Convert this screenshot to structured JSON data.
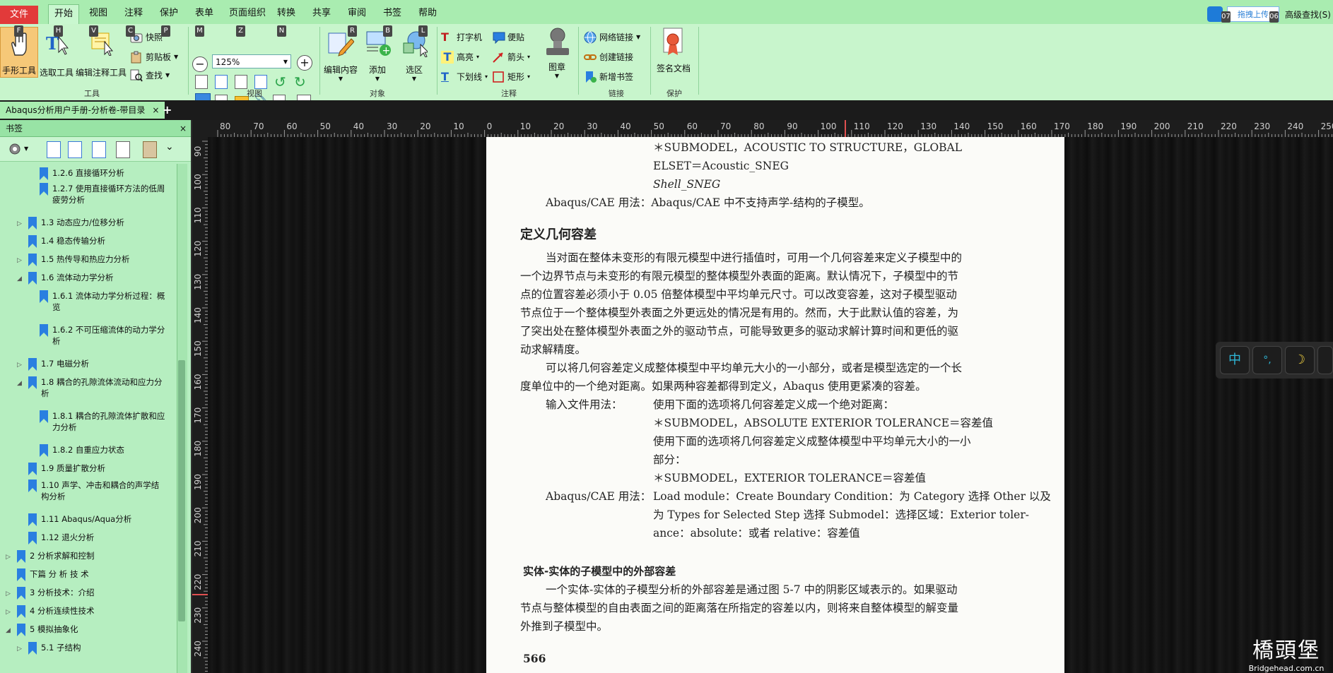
{
  "menubar": {
    "items": [
      "文件",
      "开始",
      "视图",
      "注释",
      "保护",
      "表单",
      "页面组织",
      "转换",
      "共享",
      "审阅",
      "书签",
      "帮助"
    ],
    "upload_label": "拖拽上传",
    "advanced_search": "高级查找(S)",
    "keytips_top": [
      "07",
      "06"
    ]
  },
  "ribbon": {
    "tools": {
      "hand": "手形工具",
      "select": "选取工具",
      "edit_annot": "编辑注释工具",
      "snapshot": "快照",
      "clipboard": "剪贴板",
      "find": "查找",
      "label": "工具"
    },
    "view": {
      "zoom": "125%",
      "label": "视图"
    },
    "objects": {
      "edit_content": "编辑内容",
      "add": "添加",
      "select_area": "选区",
      "label": "对象"
    },
    "annotations": {
      "typewriter": "打字机",
      "highlight": "高亮",
      "underline": "下划线",
      "note": "便贴",
      "arrow": "箭头",
      "rect": "矩形",
      "stamp": "图章",
      "label": "注释"
    },
    "links": {
      "web": "网络链接",
      "create": "创建链接",
      "bookmark": "新增书签",
      "label": "链接"
    },
    "protect": {
      "sign": "签名文档",
      "label": "保护"
    },
    "keytips": [
      "F",
      "H",
      "V",
      "C",
      "P",
      "M",
      "Z",
      "N",
      "R",
      "B",
      "L"
    ]
  },
  "tab": {
    "title": "Abaqus分析用户手册-分析卷-带目录",
    "close": "×",
    "add": "+"
  },
  "sidebar": {
    "title": "书签",
    "close": "×",
    "items": [
      {
        "label1": "1.2.6 直接循环分析",
        "label2": ""
      },
      {
        "label1": "1.2.7 使用直接循环方法的低周",
        "label2": "疲劳分析"
      },
      {
        "label1": "1.3 动态应力/位移分析",
        "label2": ""
      },
      {
        "label1": "1.4 稳态传输分析",
        "label2": ""
      },
      {
        "label1": "1.5 热传导和热应力分析",
        "label2": ""
      },
      {
        "label1": "1.6 流体动力学分析",
        "label2": ""
      },
      {
        "label1": "1.6.1 流体动力学分析过程：概",
        "label2": "览"
      },
      {
        "label1": "1.6.2 不可压缩流体的动力学分",
        "label2": "析"
      },
      {
        "label1": "1.7 电磁分析",
        "label2": ""
      },
      {
        "label1": "1.8 耦合的孔隙流体流动和应力分",
        "label2": "析"
      },
      {
        "label1": "1.8.1 耦合的孔隙流体扩散和应",
        "label2": "力分析"
      },
      {
        "label1": "1.8.2 自重应力状态",
        "label2": ""
      },
      {
        "label1": "1.9 质量扩散分析",
        "label2": ""
      },
      {
        "label1": "1.10 声学、冲击和耦合的声学结",
        "label2": "构分析"
      },
      {
        "label1": "1.11 Abaqus/Aqua分析",
        "label2": ""
      },
      {
        "label1": "1.12 退火分析",
        "label2": ""
      },
      {
        "label1": "2 分析求解和控制",
        "label2": ""
      },
      {
        "label1": "下篇 分 析 技 术",
        "label2": ""
      },
      {
        "label1": "3 分析技术：介绍",
        "label2": ""
      },
      {
        "label1": "4 分析连续性技术",
        "label2": ""
      },
      {
        "label1": "5 模拟抽象化",
        "label2": ""
      },
      {
        "label1": "5.1 子结构",
        "label2": ""
      }
    ]
  },
  "ruler": {
    "h_labels": [
      "80",
      "70",
      "60",
      "50",
      "40",
      "30",
      "20",
      "10",
      "0",
      "10",
      "20",
      "30",
      "40",
      "50",
      "60",
      "70",
      "80",
      "90",
      "100",
      "110",
      "120",
      "130",
      "140",
      "150",
      "160",
      "170",
      "180",
      "190",
      "200",
      "210",
      "220",
      "230",
      "240",
      "250"
    ],
    "v_labels": [
      "90",
      "100",
      "110",
      "120",
      "130",
      "140",
      "150",
      "160",
      "170",
      "180",
      "190",
      "200",
      "210",
      "220",
      "230",
      "240"
    ]
  },
  "page": {
    "l1": "＊SUBMODEL，ACOUSTIC TO STRUCTURE，GLOBAL",
    "l2": "ELSET＝Acoustic_SNEG",
    "l3": "Shell_SNEG",
    "l4": "Abaqus/CAE 用法：Abaqus/CAE 中不支持声学-结构的子模型。",
    "h1": "定义几何容差",
    "p1": "当对面在整体未变形的有限元模型中进行插值时，可用一个几何容差来定义子模型中的",
    "p2": "一个边界节点与未变形的有限元模型的整体模型外表面的距离。默认情况下，子模型中的节",
    "p3": "点的位置容差必须小于 0.05 倍整体模型中平均单元尺寸。可以改变容差，这对子模型驱动",
    "p4": "节点位于一个整体模型外表面之外更远处的情况是有用的。然而，大于此默认值的容差，为",
    "p5": "了突出处在整体模型外表面之外的驱动节点，可能导致更多的驱动求解计算时间和更低的驱",
    "p6": "动求解精度。",
    "p7": "可以将几何容差定义成整体模型中平均单元大小的一小部分，或者是模型选定的一个长",
    "p8": "度单位中的一个绝对距离。如果两种容差都得到定义，Abaqus 使用更紧凑的容差。",
    "p9a": "输入文件用法：",
    "p9b": "使用下面的选项将几何容差定义成一个绝对距离：",
    "p10": "＊SUBMODEL，ABSOLUTE EXTERIOR TOLERANCE＝容差值",
    "p11": "使用下面的选项将几何容差定义成整体模型中平均单元大小的一小",
    "p12": "部分：",
    "p13": "＊SUBMODEL，EXTERIOR TOLERANCE＝容差值",
    "p14a": "Abaqus/CAE 用法：",
    "p14b": "Load module：Create Boundary Condition：为 Category 选择 Other 以及",
    "p15": "为 Types for Selected Step 选择 Submodel：选择区域：Exterior toler-",
    "p16": "ance：absolute：或者 relative：容差值",
    "h2": "实体-实体的子模型中的外部容差",
    "p17": "一个实体-实体的子模型分析的外部容差是通过图 5-7 中的阴影区域表示的。如果驱动",
    "p18": "节点与整体模型的自由表面之间的距离落在所指定的容差以内，则将来自整体模型的解变量",
    "p19": "外推到子模型中。",
    "page_no": "566"
  },
  "ime": {
    "b1": "中",
    "b2": "°,",
    "b3": "☽"
  },
  "watermark": {
    "logo": "橋頭堡",
    "url": "Bridgehead.com.cn"
  }
}
